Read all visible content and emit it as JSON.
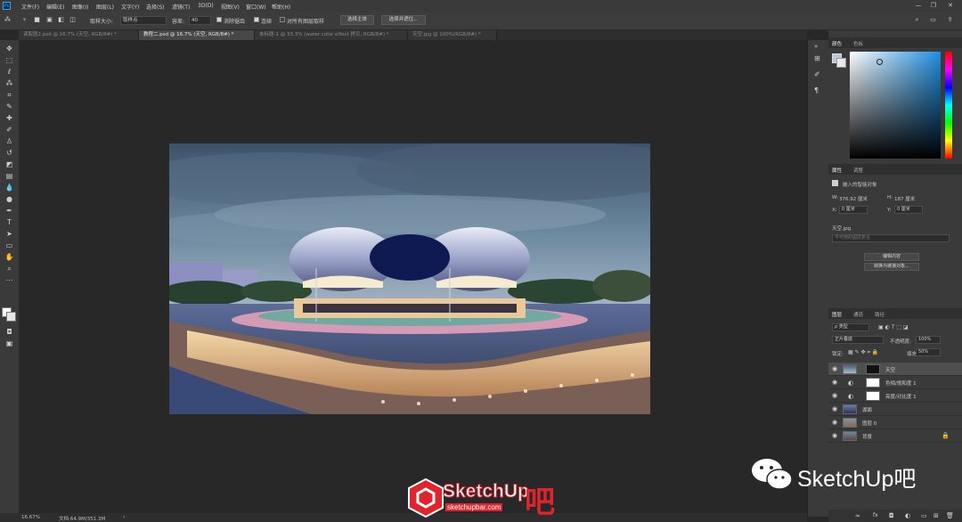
{
  "menubar": {
    "logo": "Ps",
    "items": [
      "文件(F)",
      "编辑(E)",
      "图像(I)",
      "图层(L)",
      "文字(Y)",
      "选择(S)",
      "滤镜(T)",
      "3D(D)",
      "视图(V)",
      "窗口(W)",
      "帮助(H)"
    ],
    "window_buttons": [
      "—",
      "❐",
      "✕"
    ]
  },
  "options": {
    "sample_size_label": "取样大小:",
    "sample_size_value": "取样点",
    "tolerance_label": "容差:",
    "tolerance_value": "40",
    "antialias_label": "消除锯齿",
    "contiguous_label": "连续",
    "all_layers_label": "对所有图层取样",
    "select_subject": "选择主体",
    "select_mask": "选择并遮住..."
  },
  "tabs": [
    "读取图2.psd @ 16.7% (天空, RGB/8#) *",
    "教程二.psd @ 16.7% (天空, RGB/8#) *",
    "未标题-1 @ 33.3% (water color effect 拷贝, RGB/8#) *",
    "天空.jpg @ 100%(RGB/8#) *"
  ],
  "status": {
    "zoom": "16.67%",
    "doc_size": "文档:64.9M/351.3M"
  },
  "panels": {
    "color_tabs": [
      "颜色",
      "色板"
    ],
    "props_tabs": [
      "属性",
      "调整"
    ],
    "smart_object_label": "嵌入的智能对象",
    "w_label": "W:",
    "w_value": "376.92 厘米",
    "h_label": "H:",
    "h_value": "187 厘米",
    "x_label": "X:",
    "x_value": "0 厘米",
    "y_label": "Y:",
    "y_value": "0 厘米",
    "file_name": "天空.jpg",
    "comp_placeholder": "不可用的图层复合",
    "edit_contents": "编辑内容",
    "convert_link": "转换为链接对象...",
    "layers_tabs": [
      "图层",
      "通道",
      "路径"
    ],
    "filter_kind": "ρ 类型",
    "blend_mode": "正片叠底",
    "opacity_label": "不透明度:",
    "opacity_value": "100%",
    "lock_label": "锁定:",
    "fill_label": "填充:",
    "fill_value": "50%",
    "layers": [
      {
        "name": "天空",
        "selected": true
      },
      {
        "name": "色相/饱和度 1",
        "selected": false
      },
      {
        "name": "亮度/对比度 1",
        "selected": false
      },
      {
        "name": "湖面",
        "selected": false
      },
      {
        "name": "图层 0",
        "selected": false
      },
      {
        "name": "背景",
        "selected": false
      }
    ]
  },
  "watermark": {
    "wechat_text": "SketchUp吧",
    "logo_text": "SketchUp",
    "logo_sub": "sketchupbar.com",
    "logo_char": "吧"
  },
  "colors": {
    "accent": "#31a8ff",
    "logo_red": "#e0242d"
  }
}
